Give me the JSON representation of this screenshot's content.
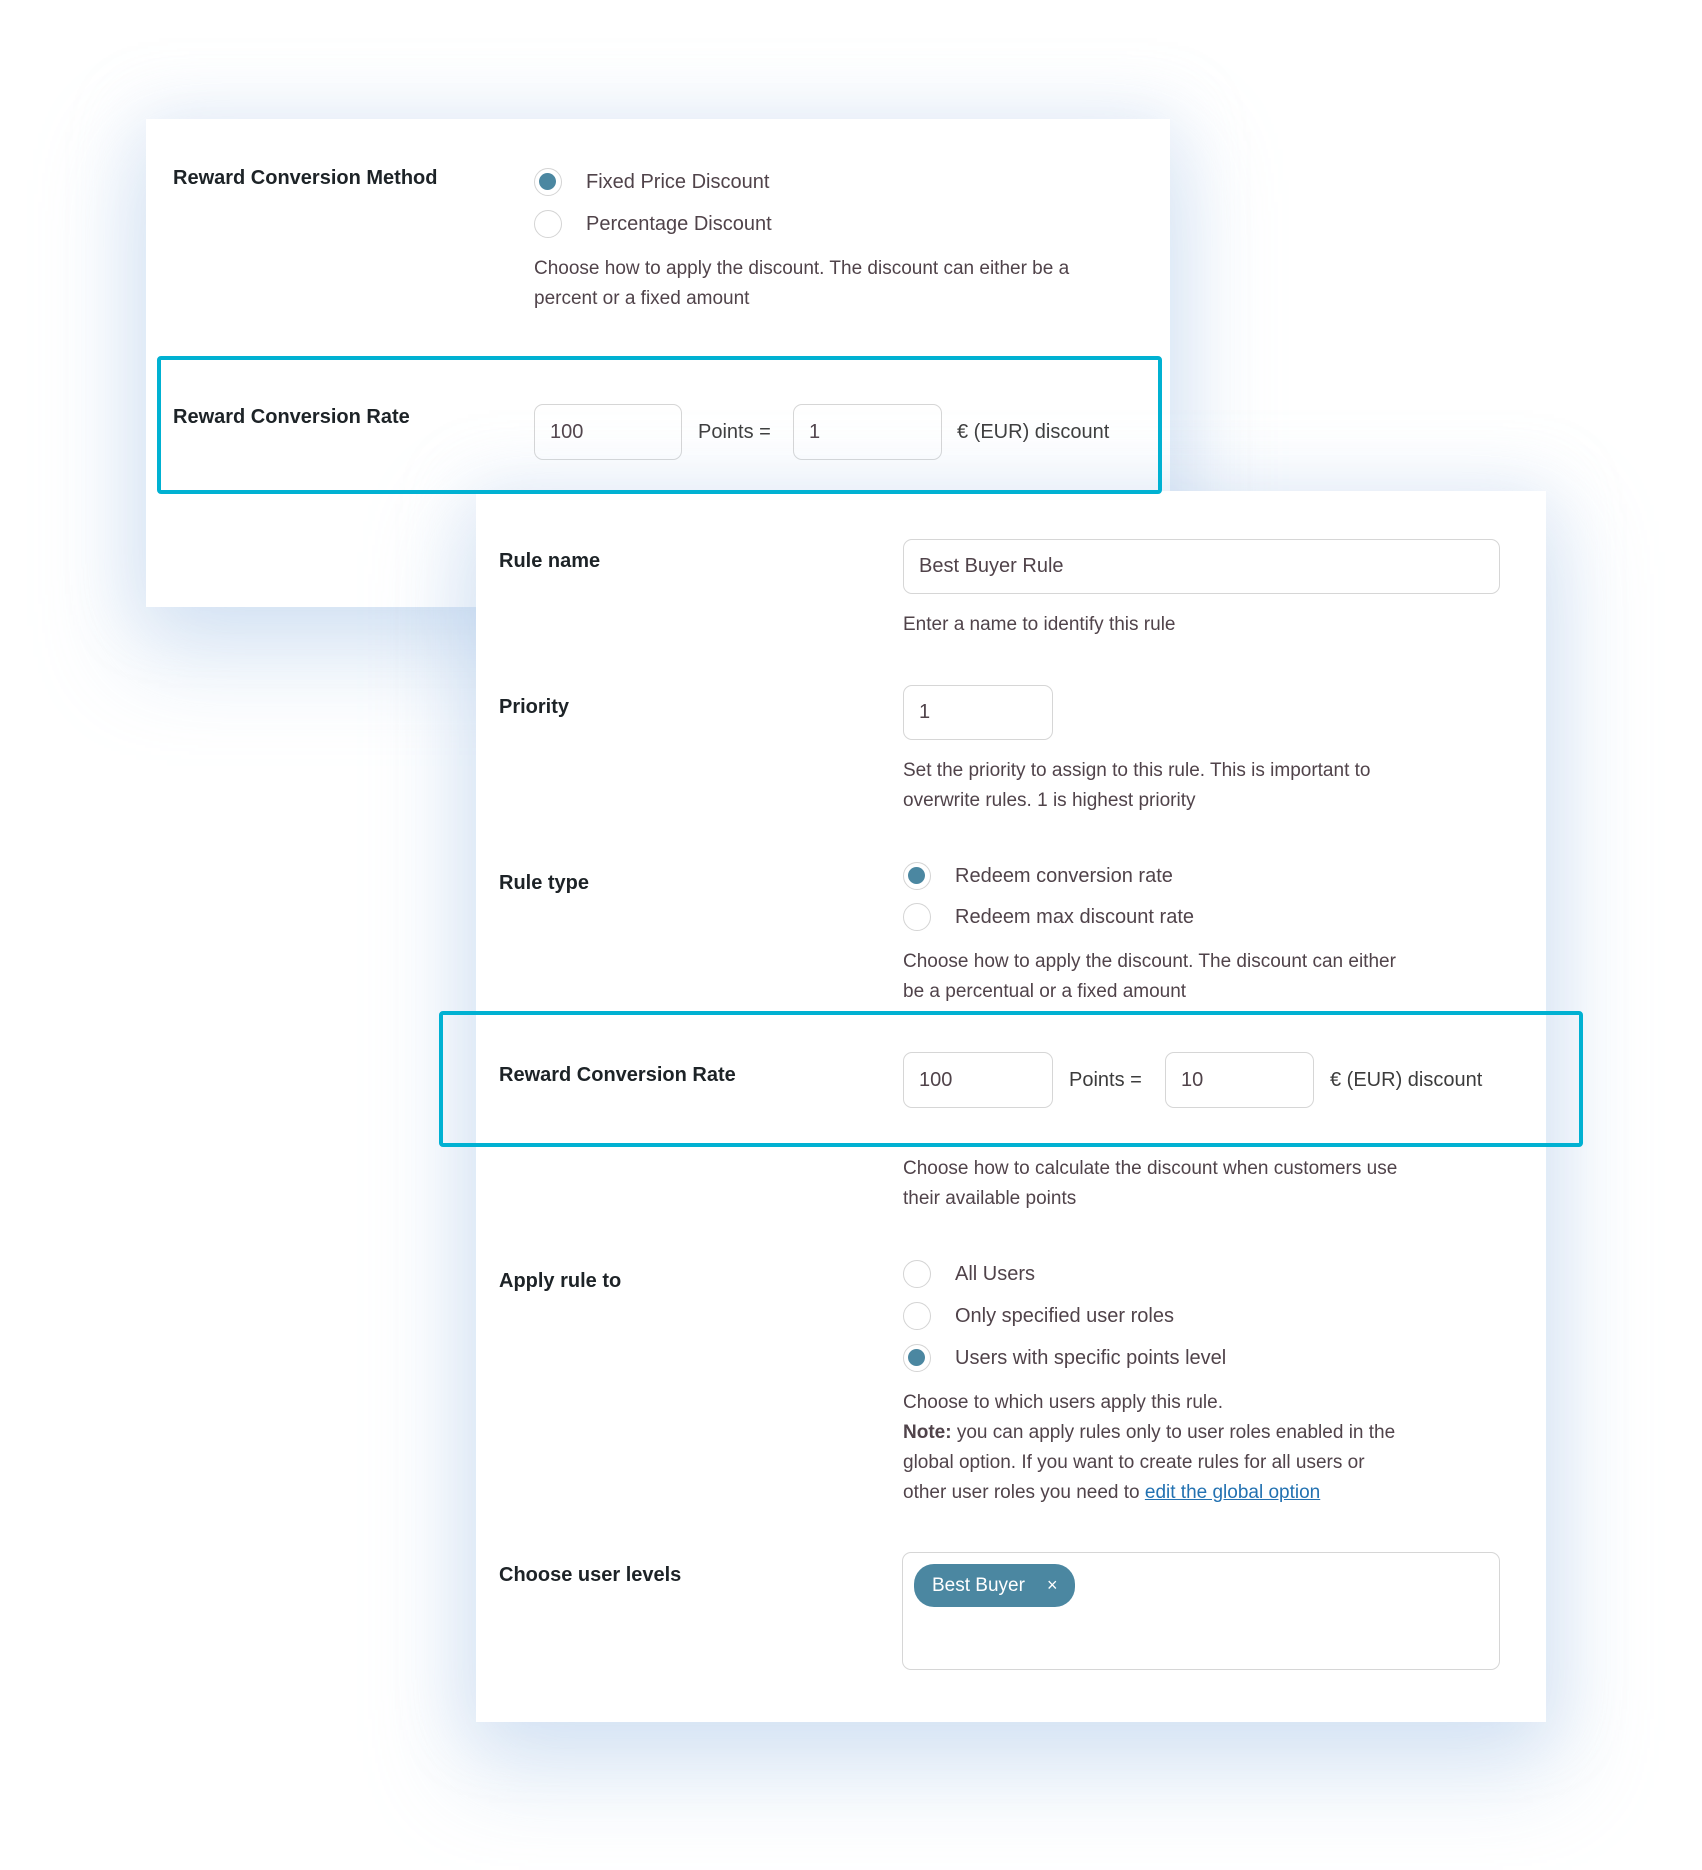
{
  "global_settings": {
    "conversion_method": {
      "label": "Reward Conversion Method",
      "options": [
        {
          "label": "Fixed Price Discount",
          "checked": true
        },
        {
          "label": "Percentage Discount",
          "checked": false
        }
      ],
      "description_lines": [
        "Choose how to apply the discount. The discount can either be a",
        "percent or a fixed amount"
      ]
    },
    "conversion_rate": {
      "label": "Reward Conversion Rate",
      "points_value": "100",
      "points_label": "Points =",
      "discount_value": "1",
      "currency_label": "€ (EUR) discount"
    }
  },
  "rule_form": {
    "rule_name": {
      "label": "Rule name",
      "value": "Best Buyer Rule",
      "hint": "Enter a name to identify this rule"
    },
    "priority": {
      "label": "Priority",
      "value": "1",
      "hint_lines": [
        "Set the priority to assign to this rule. This is important to",
        "overwrite rules. 1 is highest priority"
      ]
    },
    "rule_type": {
      "label": "Rule type",
      "options": [
        {
          "label": "Redeem conversion rate",
          "checked": true
        },
        {
          "label": "Redeem max discount rate",
          "checked": false
        }
      ],
      "hint_lines": [
        "Choose how to apply the discount. The discount can either",
        "be a percentual or a fixed amount"
      ]
    },
    "conversion_rate": {
      "label": "Reward Conversion Rate",
      "points_value": "100",
      "points_label": "Points =",
      "discount_value": "10",
      "currency_label": "€ (EUR) discount",
      "hint_lines": [
        "Choose how to calculate the discount when customers use",
        "their available points"
      ]
    },
    "apply_rule_to": {
      "label": "Apply rule to",
      "options": [
        {
          "label": "All Users",
          "checked": false
        },
        {
          "label": "Only specified user roles",
          "checked": false
        },
        {
          "label": "Users with specific points level",
          "checked": true
        }
      ],
      "hint_line1": "Choose to which users apply this rule.",
      "note_label": "Note:",
      "note_line1_rest": " you can apply rules only to user roles enabled in the",
      "note_line2": "global option. If you want to create rules for all users or",
      "note_line3_prefix": "other user roles you need to ",
      "note_link": "edit the global option"
    },
    "user_levels": {
      "label": "Choose user levels",
      "selected": [
        {
          "label": "Best Buyer",
          "remove_icon": "×"
        }
      ]
    }
  },
  "colors": {
    "accent_radio": "#4b87a1",
    "highlight_border": "#00b1d2",
    "link": "#2271b1",
    "label_text": "#1d2327",
    "body_text": "#50434a"
  }
}
